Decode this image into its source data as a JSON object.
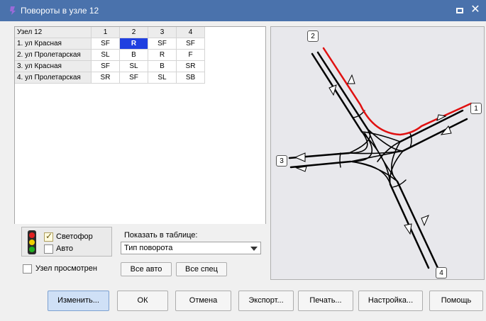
{
  "window": {
    "title": "Повороты в узле 12",
    "close_glyph": "✕"
  },
  "table": {
    "corner": "Узел 12",
    "columns": [
      "1",
      "2",
      "3",
      "4"
    ],
    "rows": [
      {
        "label": "1. ул Красная",
        "cells": [
          "SF",
          "R",
          "SF",
          "SF"
        ]
      },
      {
        "label": "2. ул Пролетарская",
        "cells": [
          "SL",
          "B",
          "R",
          "F"
        ]
      },
      {
        "label": "3. ул Красная",
        "cells": [
          "SF",
          "SL",
          "B",
          "SR"
        ]
      },
      {
        "label": "4. ул Пролетарская",
        "cells": [
          "SR",
          "SF",
          "SL",
          "SB"
        ]
      }
    ],
    "selected": {
      "row": 0,
      "col": 1
    },
    "selected_color": "#1f3fe0"
  },
  "controls": {
    "signal_label": "Светофор",
    "signal_checked": true,
    "auto_label": "Авто",
    "auto_checked": false,
    "node_viewed_label": "Узел просмотрен",
    "node_viewed_checked": false,
    "show_in_table_label": "Показать в таблице:",
    "show_in_table_value": "Тип поворота",
    "all_auto_button": "Все авто",
    "all_spec_button": "Все спец"
  },
  "diagram": {
    "nodes": [
      "1",
      "2",
      "3",
      "4"
    ],
    "highlight_color": "#e01010",
    "road_color": "#000000"
  },
  "footer": {
    "change": "Изменить...",
    "ok": "ОК",
    "cancel": "Отмена",
    "export": "Экспорт...",
    "print": "Печать...",
    "settings": "Настройка...",
    "help": "Помощь"
  }
}
